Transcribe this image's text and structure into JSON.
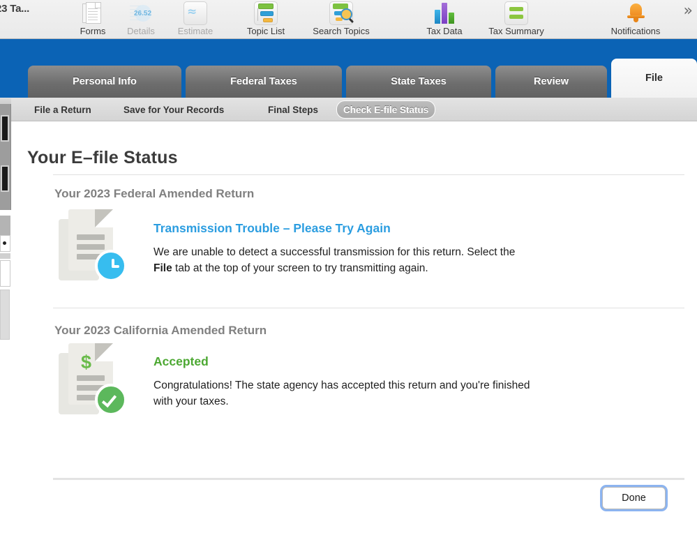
{
  "window": {
    "title": "23 Ta..."
  },
  "toolbar": {
    "items": [
      {
        "label": "Forms",
        "icon": "forms-icon",
        "enabled": true
      },
      {
        "label": "Details",
        "icon": "details-icon",
        "enabled": false
      },
      {
        "label": "Estimate",
        "icon": "estimate-icon",
        "enabled": false
      },
      {
        "label": "Topic List",
        "icon": "topic-list-icon",
        "enabled": true
      },
      {
        "label": "Search Topics",
        "icon": "search-topics-icon",
        "enabled": true
      },
      {
        "label": "Tax Data",
        "icon": "bar-chart-icon",
        "enabled": true
      },
      {
        "label": "Tax Summary",
        "icon": "summary-icon",
        "enabled": true
      },
      {
        "label": "Notifications",
        "icon": "bell-icon",
        "enabled": true
      }
    ],
    "overflow_icon": "chevron-double-right-icon"
  },
  "main_tabs": [
    {
      "label": "Personal Info",
      "active": false
    },
    {
      "label": "Federal Taxes",
      "active": false
    },
    {
      "label": "State Taxes",
      "active": false
    },
    {
      "label": "Review",
      "active": false
    },
    {
      "label": "File",
      "active": true
    }
  ],
  "sub_nav": [
    {
      "label": "File a Return",
      "selected": false
    },
    {
      "label": "Save for Your Records",
      "selected": false
    },
    {
      "label": "Final Steps",
      "selected": false
    },
    {
      "label": "Check E-file Status",
      "selected": true
    }
  ],
  "page": {
    "title": "Your E–file Status",
    "sections": [
      {
        "heading": "Your 2023 Federal Amended Return",
        "status_title": "Transmission Trouble – Please Try Again",
        "status_color": "#2b9de0",
        "icon": "document-clock-icon",
        "body_part1": "We are unable to detect a successful transmission for this return. Select the ",
        "body_bold": "File",
        "body_part2": " tab at the top of your screen to try transmitting again."
      },
      {
        "heading": "Your 2023 California Amended Return",
        "status_title": "Accepted",
        "status_color": "#4ca832",
        "icon": "document-dollar-check-icon",
        "body_part1": "Congratulations! The state agency has accepted this return and you're finished with your taxes.",
        "body_bold": "",
        "body_part2": ""
      }
    ],
    "done_button": "Done"
  },
  "colors": {
    "band_blue": "#0b63b5",
    "accent_blue": "#2b9de0",
    "accent_green": "#4ca832",
    "clock_badge": "#37bdef",
    "check_badge": "#5cb85c",
    "focus_ring": "#8cb4f0"
  }
}
